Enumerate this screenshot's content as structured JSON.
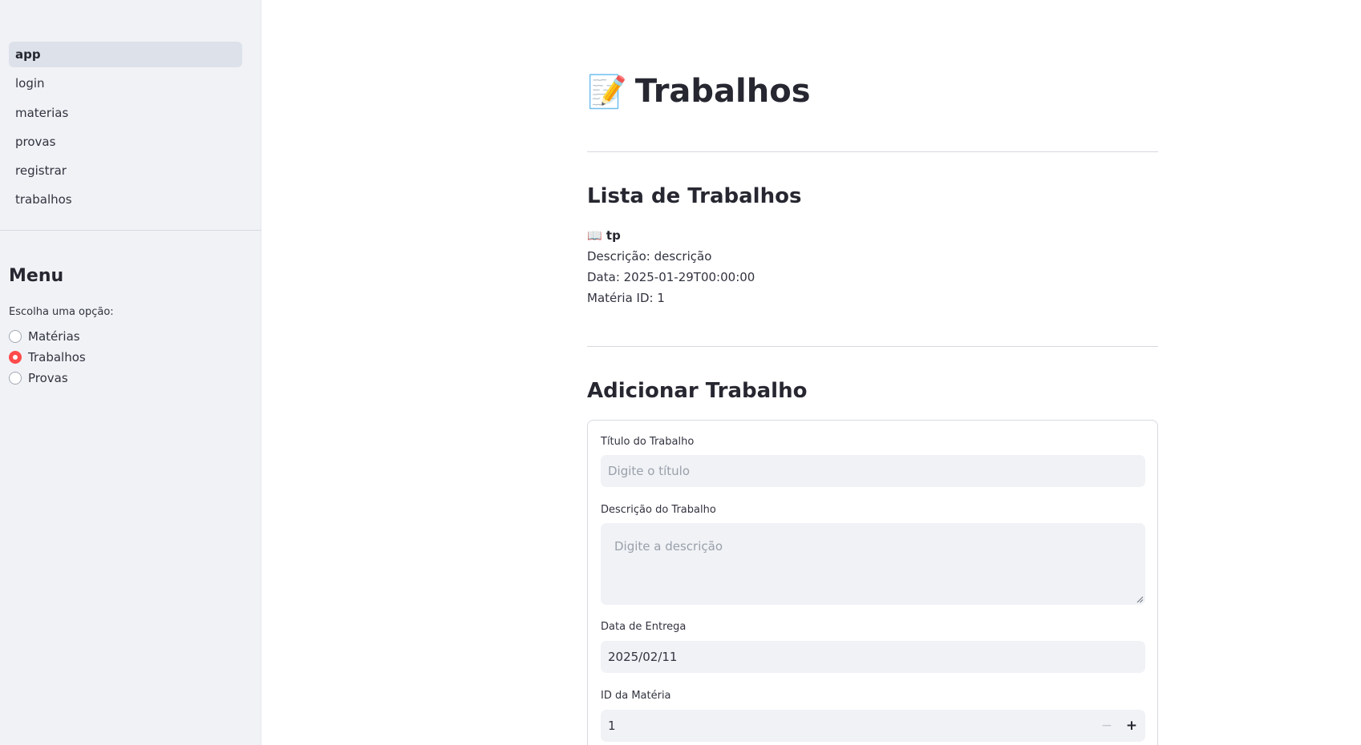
{
  "sidebar": {
    "nav_items": [
      {
        "label": "app",
        "active": true
      },
      {
        "label": "login",
        "active": false
      },
      {
        "label": "materias",
        "active": false
      },
      {
        "label": "provas",
        "active": false
      },
      {
        "label": "registrar",
        "active": false
      },
      {
        "label": "trabalhos",
        "active": false
      }
    ],
    "menu_title": "Menu",
    "radio_label": "Escolha uma opção:",
    "radio_options": [
      {
        "label": "Matérias",
        "checked": false
      },
      {
        "label": "Trabalhos",
        "checked": true
      },
      {
        "label": "Provas",
        "checked": false
      }
    ]
  },
  "main": {
    "title_emoji": "📝",
    "title": "Trabalhos",
    "list_heading": "Lista de Trabalhos",
    "item": {
      "emoji": "📖",
      "title": "tp",
      "description": "Descrição: descrição",
      "date": "Data: 2025-01-29T00:00:00",
      "materia": "Matéria ID: 1"
    },
    "add_heading": "Adicionar Trabalho",
    "form": {
      "title_label": "Título do Trabalho",
      "title_placeholder": "Digite o título",
      "description_label": "Descrição do Trabalho",
      "description_placeholder": "Digite a descrição",
      "date_label": "Data de Entrega",
      "date_value": "2025/02/11",
      "materia_label": "ID da Matéria",
      "materia_value": "1",
      "minus_symbol": "−",
      "plus_symbol": "+"
    }
  },
  "colors": {
    "accent": "#ff4b4b",
    "sidebar_bg": "#f0f2f6",
    "input_bg": "#f0f2f6",
    "text": "#31333f"
  }
}
